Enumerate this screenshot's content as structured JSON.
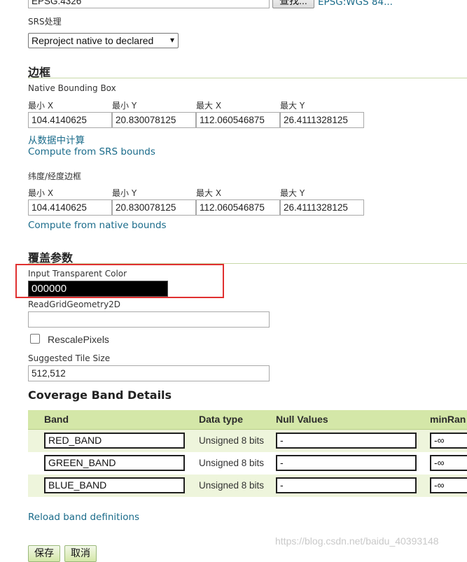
{
  "srs": {
    "declared_value": "EPSG:4326",
    "find_label": "查找...",
    "wgs_link": "EPSG:WGS 84...",
    "handling_label": "SRS处理",
    "handling_selected": "Reproject native to declared"
  },
  "bbox": {
    "title": "边框",
    "native_label": "Native Bounding Box",
    "col_labels": [
      "最小 X",
      "最小 Y",
      "最大 X",
      "最大 Y"
    ],
    "native_values": [
      "104.4140625",
      "20.830078125",
      "112.060546875",
      "26.4111328125"
    ],
    "compute_from_data": "从数据中计算",
    "compute_from_srs": "Compute from SRS bounds",
    "latlon_label": "纬度/经度边框",
    "latlon_values": [
      "104.4140625",
      "20.830078125",
      "112.060546875",
      "26.4111328125"
    ],
    "compute_from_native": "Compute from native bounds"
  },
  "coverage": {
    "title": "覆盖参数",
    "transparent_color_label": "Input Transparent Color",
    "transparent_color_value": "000000",
    "read_grid_label": "ReadGridGeometry2D",
    "read_grid_value": "",
    "rescale_label": "RescalePixels",
    "rescale_checked": false,
    "tile_size_label": "Suggested Tile Size",
    "tile_size_value": "512,512"
  },
  "bands": {
    "title": "Coverage Band Details",
    "headers": [
      "Band",
      "Data type",
      "Null Values",
      "minRan"
    ],
    "rows": [
      {
        "band": "RED_BAND",
        "type": "Unsigned 8 bits",
        "null": "-",
        "min": "-∞"
      },
      {
        "band": "GREEN_BAND",
        "type": "Unsigned 8 bits",
        "null": "-",
        "min": "-∞"
      },
      {
        "band": "BLUE_BAND",
        "type": "Unsigned 8 bits",
        "null": "-",
        "min": "-∞"
      }
    ],
    "reload_link": "Reload band definitions"
  },
  "footer": {
    "save_label": "保存",
    "cancel_label": "取消"
  },
  "watermark": "https://blog.csdn.net/baidu_40393148",
  "colors": {
    "link": "#1a6b8a",
    "table_header_bg": "#d4e7a8",
    "table_row_alt_bg": "#eef5dc",
    "highlight_box": "#e03030"
  }
}
